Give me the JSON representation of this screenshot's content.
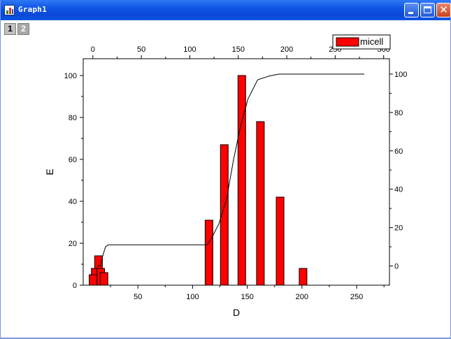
{
  "window": {
    "title": "Graph1",
    "icon": "origin-graph-icon"
  },
  "layer_tabs": [
    {
      "label": "1",
      "active": true
    },
    {
      "label": "2",
      "active": false
    }
  ],
  "title_buttons": {
    "close_glyph": "✕"
  },
  "colors": {
    "bar_fill": "#ff0000",
    "bar_stroke": "#000000",
    "line": "#000000",
    "titlebar": "#0a48d6"
  },
  "chart_data": {
    "type": "bar",
    "xlabel": "D",
    "ylabel": "E",
    "xlim": [
      0,
      280
    ],
    "ylim": [
      0,
      108
    ],
    "x_ticks": [
      50,
      100,
      150,
      200,
      250
    ],
    "y_ticks": [
      0,
      20,
      40,
      60,
      80,
      100
    ],
    "top_xlim": [
      -10,
      306
    ],
    "top_x_ticks": [
      0,
      50,
      100,
      150,
      200,
      250,
      300
    ],
    "right_ylim": [
      -10,
      108
    ],
    "right_y_ticks": [
      0,
      20,
      40,
      60,
      80,
      100
    ],
    "legend": {
      "position": "top-right",
      "label": "micell"
    },
    "series": [
      {
        "name": "micell",
        "type": "bar",
        "x": [
          9,
          11,
          14,
          16,
          19,
          115,
          129,
          145,
          162,
          180,
          201
        ],
        "values": [
          5,
          8,
          14,
          8,
          6,
          31,
          67,
          100,
          78,
          42,
          8
        ]
      },
      {
        "type": "line",
        "axis": "top-right",
        "x": [
          5,
          8,
          10,
          13,
          16,
          40,
          80,
          118,
          123,
          130,
          138,
          145,
          152,
          160,
          170,
          182,
          192,
          202,
          215,
          240,
          280
        ],
        "y": [
          0,
          0,
          5,
          10,
          11,
          11,
          11,
          11,
          15,
          22,
          35,
          55,
          72,
          87,
          97,
          99,
          100,
          100,
          100,
          100,
          100
        ]
      }
    ]
  }
}
